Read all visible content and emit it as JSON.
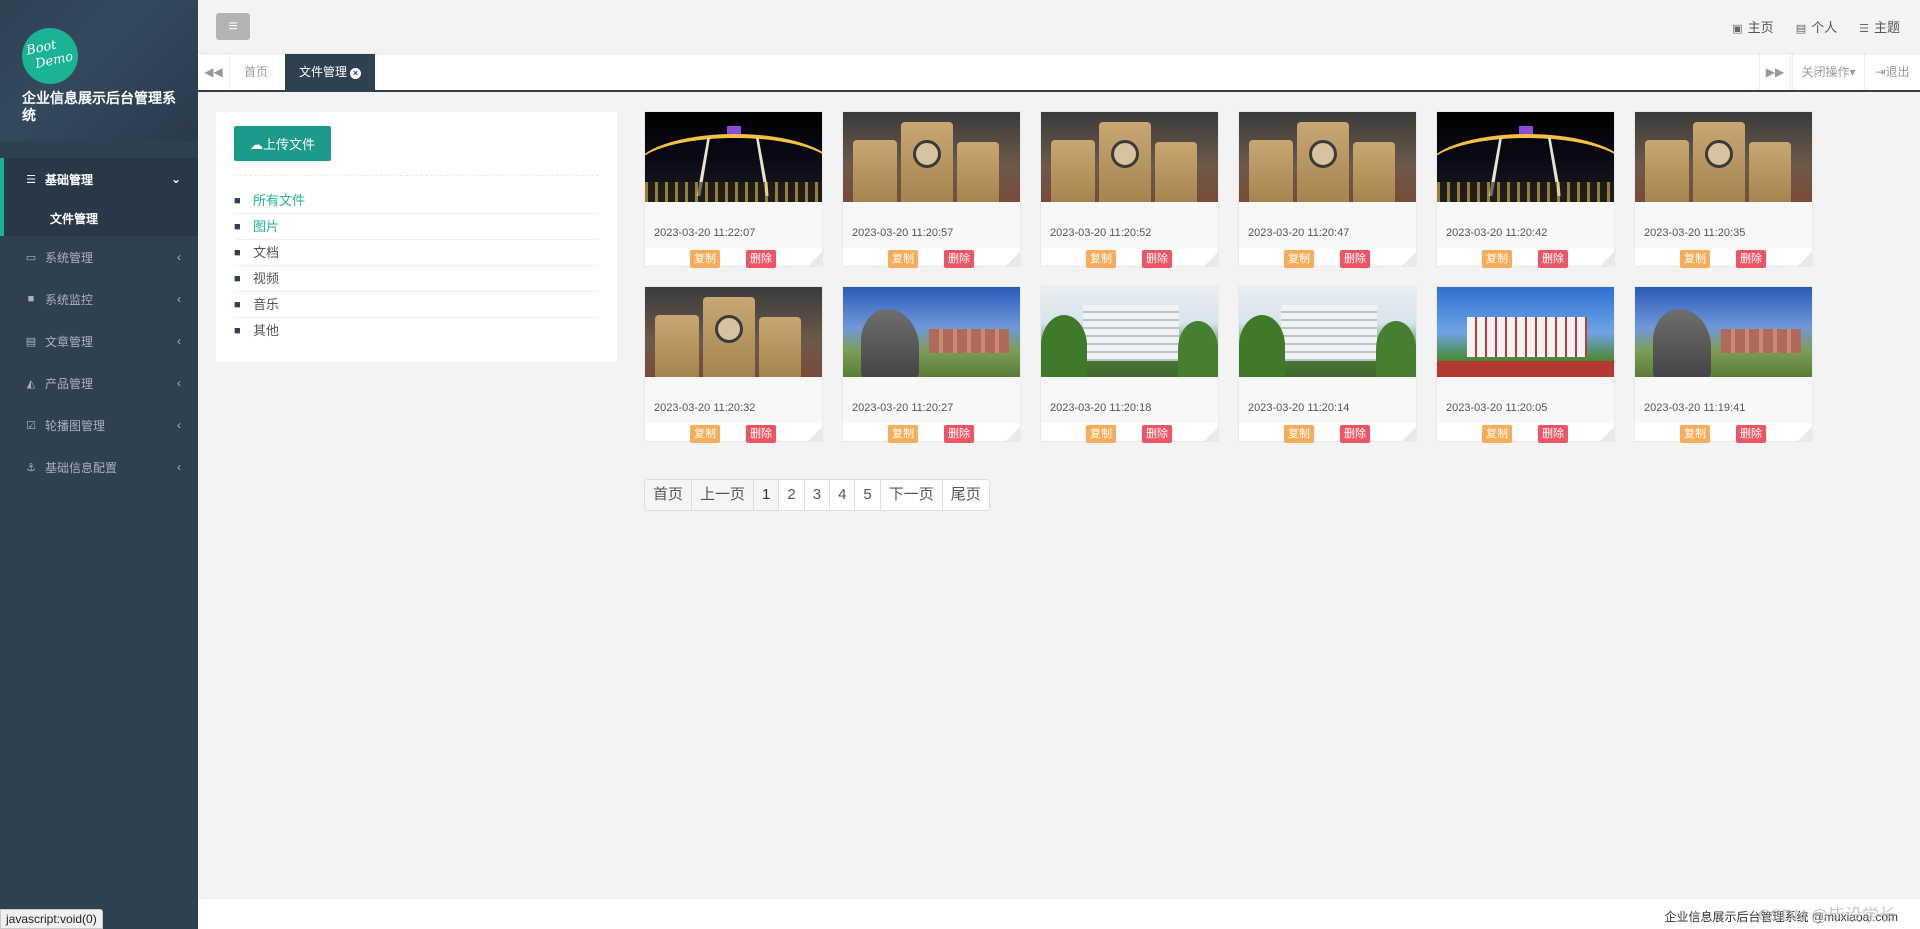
{
  "brand": {
    "logo_line1": "Boot",
    "logo_line2": "Demo",
    "title": "企业信息展示后台管理系统"
  },
  "sidebar": {
    "items": [
      {
        "label": "基础管理",
        "icon": "bars-icon",
        "active": true
      },
      {
        "label": "系统管理",
        "icon": "desktop-icon"
      },
      {
        "label": "系统监控",
        "icon": "video-camera-icon"
      },
      {
        "label": "文章管理",
        "icon": "id-card-icon"
      },
      {
        "label": "产品管理",
        "icon": "area-chart-icon"
      },
      {
        "label": "轮播图管理",
        "icon": "calendar-check-icon"
      },
      {
        "label": "基础信息配置",
        "icon": "anchor-icon"
      }
    ],
    "sub_items": [
      {
        "label": "文件管理",
        "active": true
      }
    ]
  },
  "header": {
    "links": [
      {
        "label": "主页",
        "icon": "rss-icon"
      },
      {
        "label": "个人",
        "icon": "id-card-icon"
      },
      {
        "label": "主题",
        "icon": "list-icon"
      }
    ]
  },
  "tabs": {
    "items": [
      {
        "label": "首页"
      },
      {
        "label": "文件管理",
        "active": true
      }
    ],
    "close_ops": "关闭操作",
    "logout": "退出"
  },
  "file_panel": {
    "upload_label": "上传文件",
    "folders": [
      "所有文件",
      "图片",
      "文档",
      "视频",
      "音乐",
      "其他"
    ],
    "selected_folder": "所有文件"
  },
  "files": [
    {
      "date": "2023-03-20 11:22:07",
      "thumb": "arch"
    },
    {
      "date": "2023-03-20 11:20:57",
      "thumb": "bag"
    },
    {
      "date": "2023-03-20 11:20:52",
      "thumb": "bag"
    },
    {
      "date": "2023-03-20 11:20:47",
      "thumb": "bag"
    },
    {
      "date": "2023-03-20 11:20:42",
      "thumb": "arch"
    },
    {
      "date": "2023-03-20 11:20:35",
      "thumb": "bag"
    },
    {
      "date": "2023-03-20 11:20:32",
      "thumb": "bag"
    },
    {
      "date": "2023-03-20 11:20:27",
      "thumb": "rock"
    },
    {
      "date": "2023-03-20 11:20:18",
      "thumb": "white"
    },
    {
      "date": "2023-03-20 11:20:14",
      "thumb": "white"
    },
    {
      "date": "2023-03-20 11:20:05",
      "thumb": "red"
    },
    {
      "date": "2023-03-20 11:19:41",
      "thumb": "rock"
    }
  ],
  "file_actions": {
    "copy": "复制",
    "delete": "删除"
  },
  "pagination": {
    "first": "首页",
    "prev": "上一页",
    "pages": [
      "1",
      "2",
      "3",
      "4",
      "5"
    ],
    "current": "1",
    "next": "下一页",
    "last": "尾页"
  },
  "footer": {
    "text": "企业信息展示后台管理系统 @muxiaoai.com",
    "watermark": "CSDN @毕设学长"
  },
  "status_bar": {
    "text": "javascript:void(0)"
  },
  "colors": {
    "sidebar": "#2f4050",
    "accent": "#1ab394",
    "copy": "#f8ac59",
    "delete": "#ed5565"
  }
}
